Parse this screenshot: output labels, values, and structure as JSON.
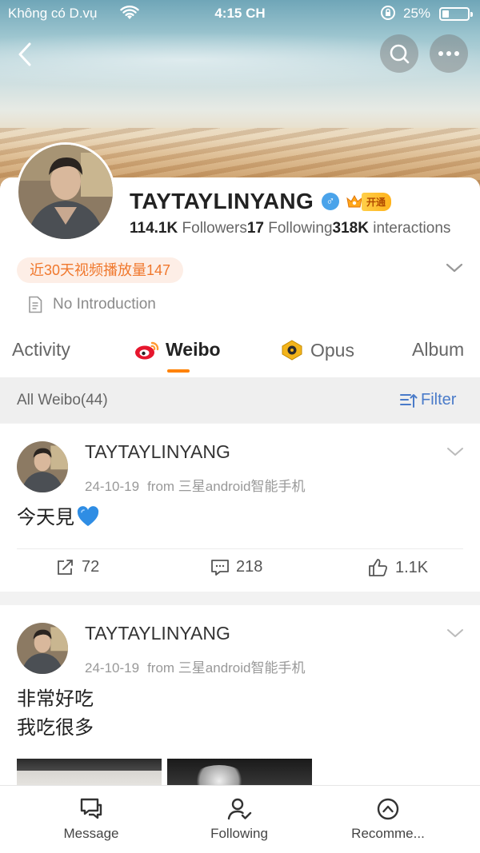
{
  "status_bar": {
    "carrier": "Không có D.vụ",
    "time": "4:15 CH",
    "battery_text": "25%",
    "battery_level": 0.25
  },
  "header": {
    "icons": [
      "back-arrow-icon",
      "search-icon",
      "more-icon"
    ]
  },
  "profile": {
    "name": "TAYTAYLINYANG",
    "gender_symbol": "♂",
    "vip_label": "开通",
    "followers_count": "114.1K",
    "followers_label": "Followers",
    "following_count": "17",
    "following_label": "Following",
    "interactions_count": "318K",
    "interactions_label": "interactions",
    "views_badge": "近30天视频播放量147",
    "intro": "No Introduction"
  },
  "tabs": [
    {
      "label": "Activity",
      "active": false
    },
    {
      "label": "Weibo",
      "active": true
    },
    {
      "label": "Opus",
      "active": false
    },
    {
      "label": "Album",
      "active": false
    }
  ],
  "filter_bar": {
    "all_label": "All Weibo(44)",
    "filter_label": "Filter"
  },
  "posts": [
    {
      "author": "TAYTAYLINYANG",
      "date": "24-10-19",
      "source": "from 三星android智能手机",
      "text": "今天見",
      "emoji": "blue-heart",
      "reposts": "72",
      "comments": "218",
      "likes": "1.1K"
    },
    {
      "author": "TAYTAYLINYANG",
      "date": "24-10-19",
      "source": "from 三星android智能手机",
      "text_line1": "非常好吃",
      "text_line2": "我吃很多"
    }
  ],
  "bottom_nav": [
    {
      "label": "Message",
      "icon": "message-icon"
    },
    {
      "label": "Following",
      "icon": "follow-user-icon"
    },
    {
      "label": "Recomme...",
      "icon": "recommend-compass-icon"
    }
  ],
  "colors": {
    "accent_orange": "#ff8200",
    "link_blue": "#4a7bc9",
    "badge_orange": "#f0782d",
    "gender_blue": "#4aa3ea"
  }
}
